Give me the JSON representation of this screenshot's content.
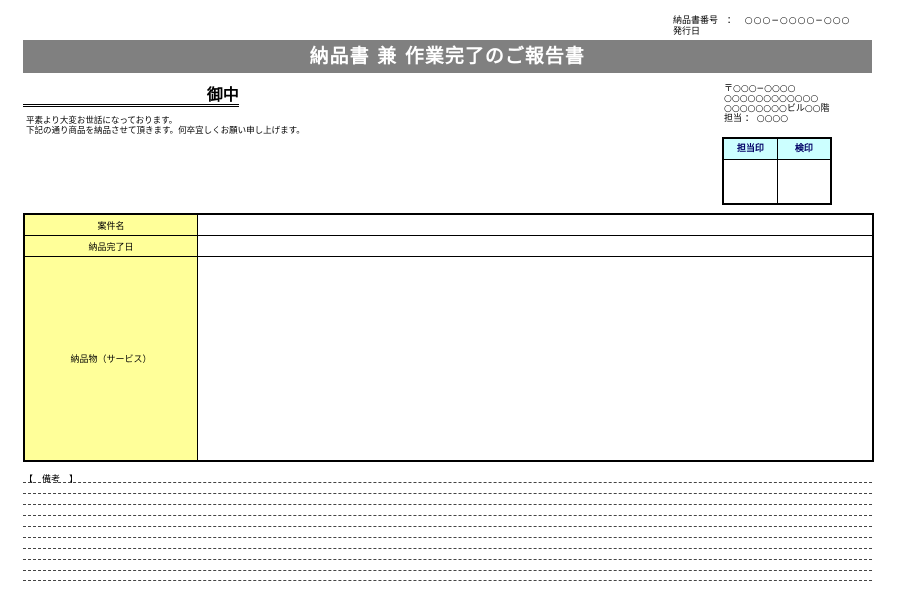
{
  "meta": {
    "invoice_no_label": "納品書番号",
    "invoice_no_sep": "：",
    "invoice_no_value": "○○○−○○○○−○○○",
    "issue_date_label": "発行日"
  },
  "title": "納品書 兼 作業完了のご報告書",
  "recipient": {
    "suffix": "御中"
  },
  "greeting": {
    "line1": "平素より大変お世話になっております。",
    "line2": "下記の通り商品を納品させて頂きます。何卒宜しくお願い申し上げます。"
  },
  "sender": {
    "postal": "〒○○○−○○○○",
    "address1": "○○○○○○○○○○○○",
    "address2": "○○○○○○○○ビル○○階",
    "person": "担当 ： ○○○○"
  },
  "stamp": {
    "person_label": "担当印",
    "inspection_label": "検印"
  },
  "table": {
    "project_label": "案件名",
    "completion_label": "納品完了日",
    "deliverable_label": "納品物（サービス）"
  },
  "remarks": {
    "label": "【　備考　】"
  },
  "colors": {
    "title_bar": "#808080",
    "label_bg": "#ffff99",
    "stamp_header_bg": "#ccffff"
  }
}
